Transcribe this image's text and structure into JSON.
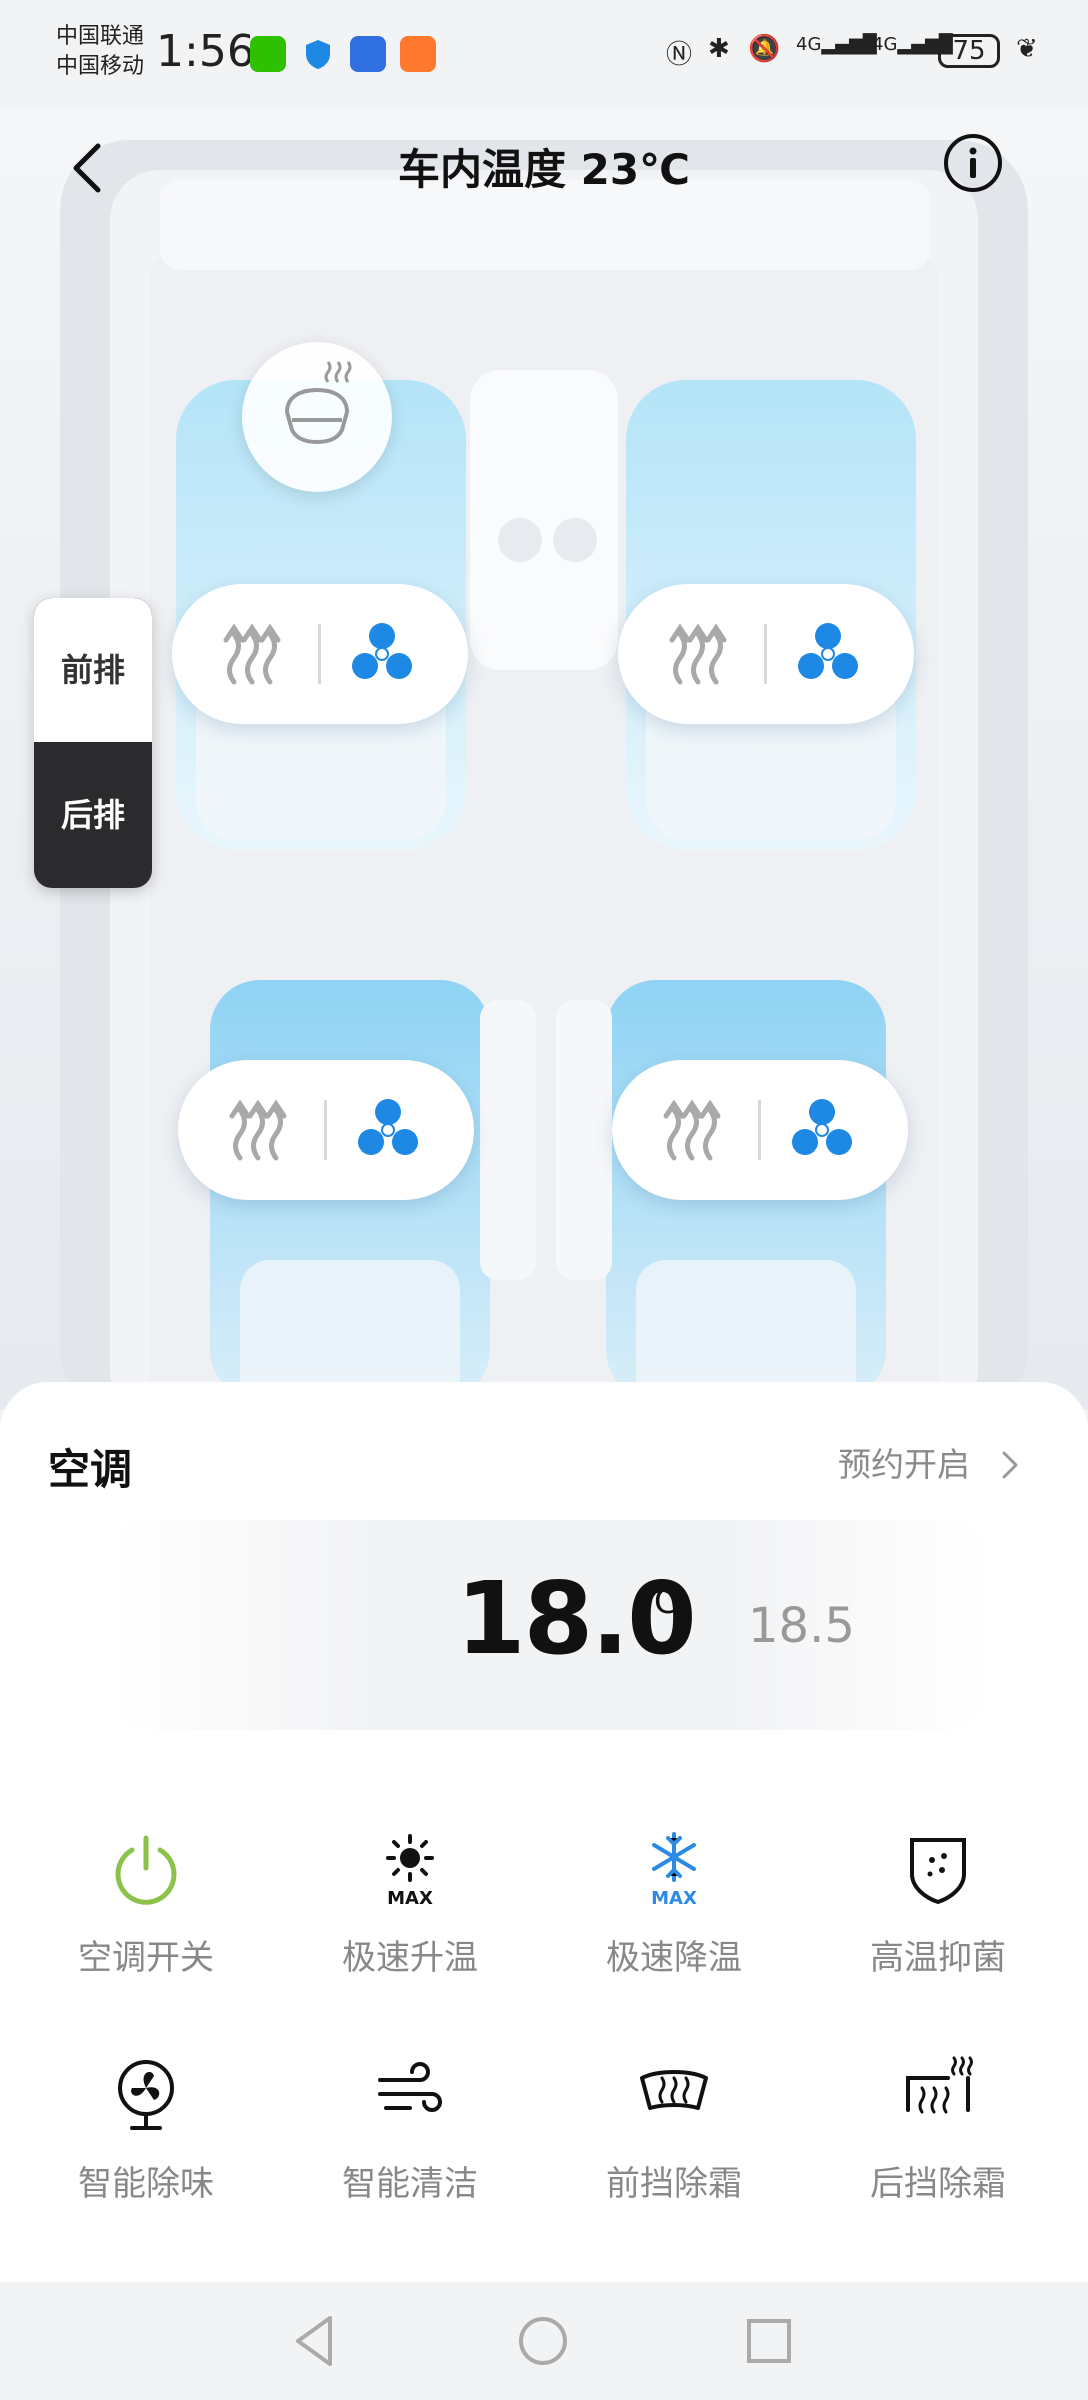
{
  "status_bar": {
    "carrier_1": "中国联通",
    "carrier_2": "中国移动",
    "time": "1:56",
    "network_1": "4G",
    "network_2": "4G",
    "battery": "75"
  },
  "header": {
    "title": "车内温度 23℃"
  },
  "row_toggle": {
    "front": "前排",
    "back": "后排",
    "selected": "后排"
  },
  "climate": {
    "title": "空调",
    "schedule": "预约开启",
    "temperature": "18.0",
    "unit": "℃",
    "next_temperature": "18.5"
  },
  "functions": [
    {
      "label": "空调开关",
      "icon": "power-icon",
      "color": "#8bc34a"
    },
    {
      "label": "极速升温",
      "icon": "sun-max-icon",
      "color": "#111111"
    },
    {
      "label": "极速降温",
      "icon": "snowflake-max-icon",
      "color": "#2b8ae6"
    },
    {
      "label": "高温抑菌",
      "icon": "shield-dots-icon",
      "color": "#111111"
    },
    {
      "label": "智能除味",
      "icon": "fan-icon",
      "color": "#111111"
    },
    {
      "label": "智能清洁",
      "icon": "wind-icon",
      "color": "#111111"
    },
    {
      "label": "前挡除霜",
      "icon": "front-defrost-icon",
      "color": "#111111"
    },
    {
      "label": "后挡除霜",
      "icon": "rear-defrost-icon",
      "color": "#111111"
    }
  ],
  "colors": {
    "fan_blue": "#1e88e5",
    "seat_blue": "#8fd3f4",
    "heat_gray": "#a9a9a9"
  }
}
